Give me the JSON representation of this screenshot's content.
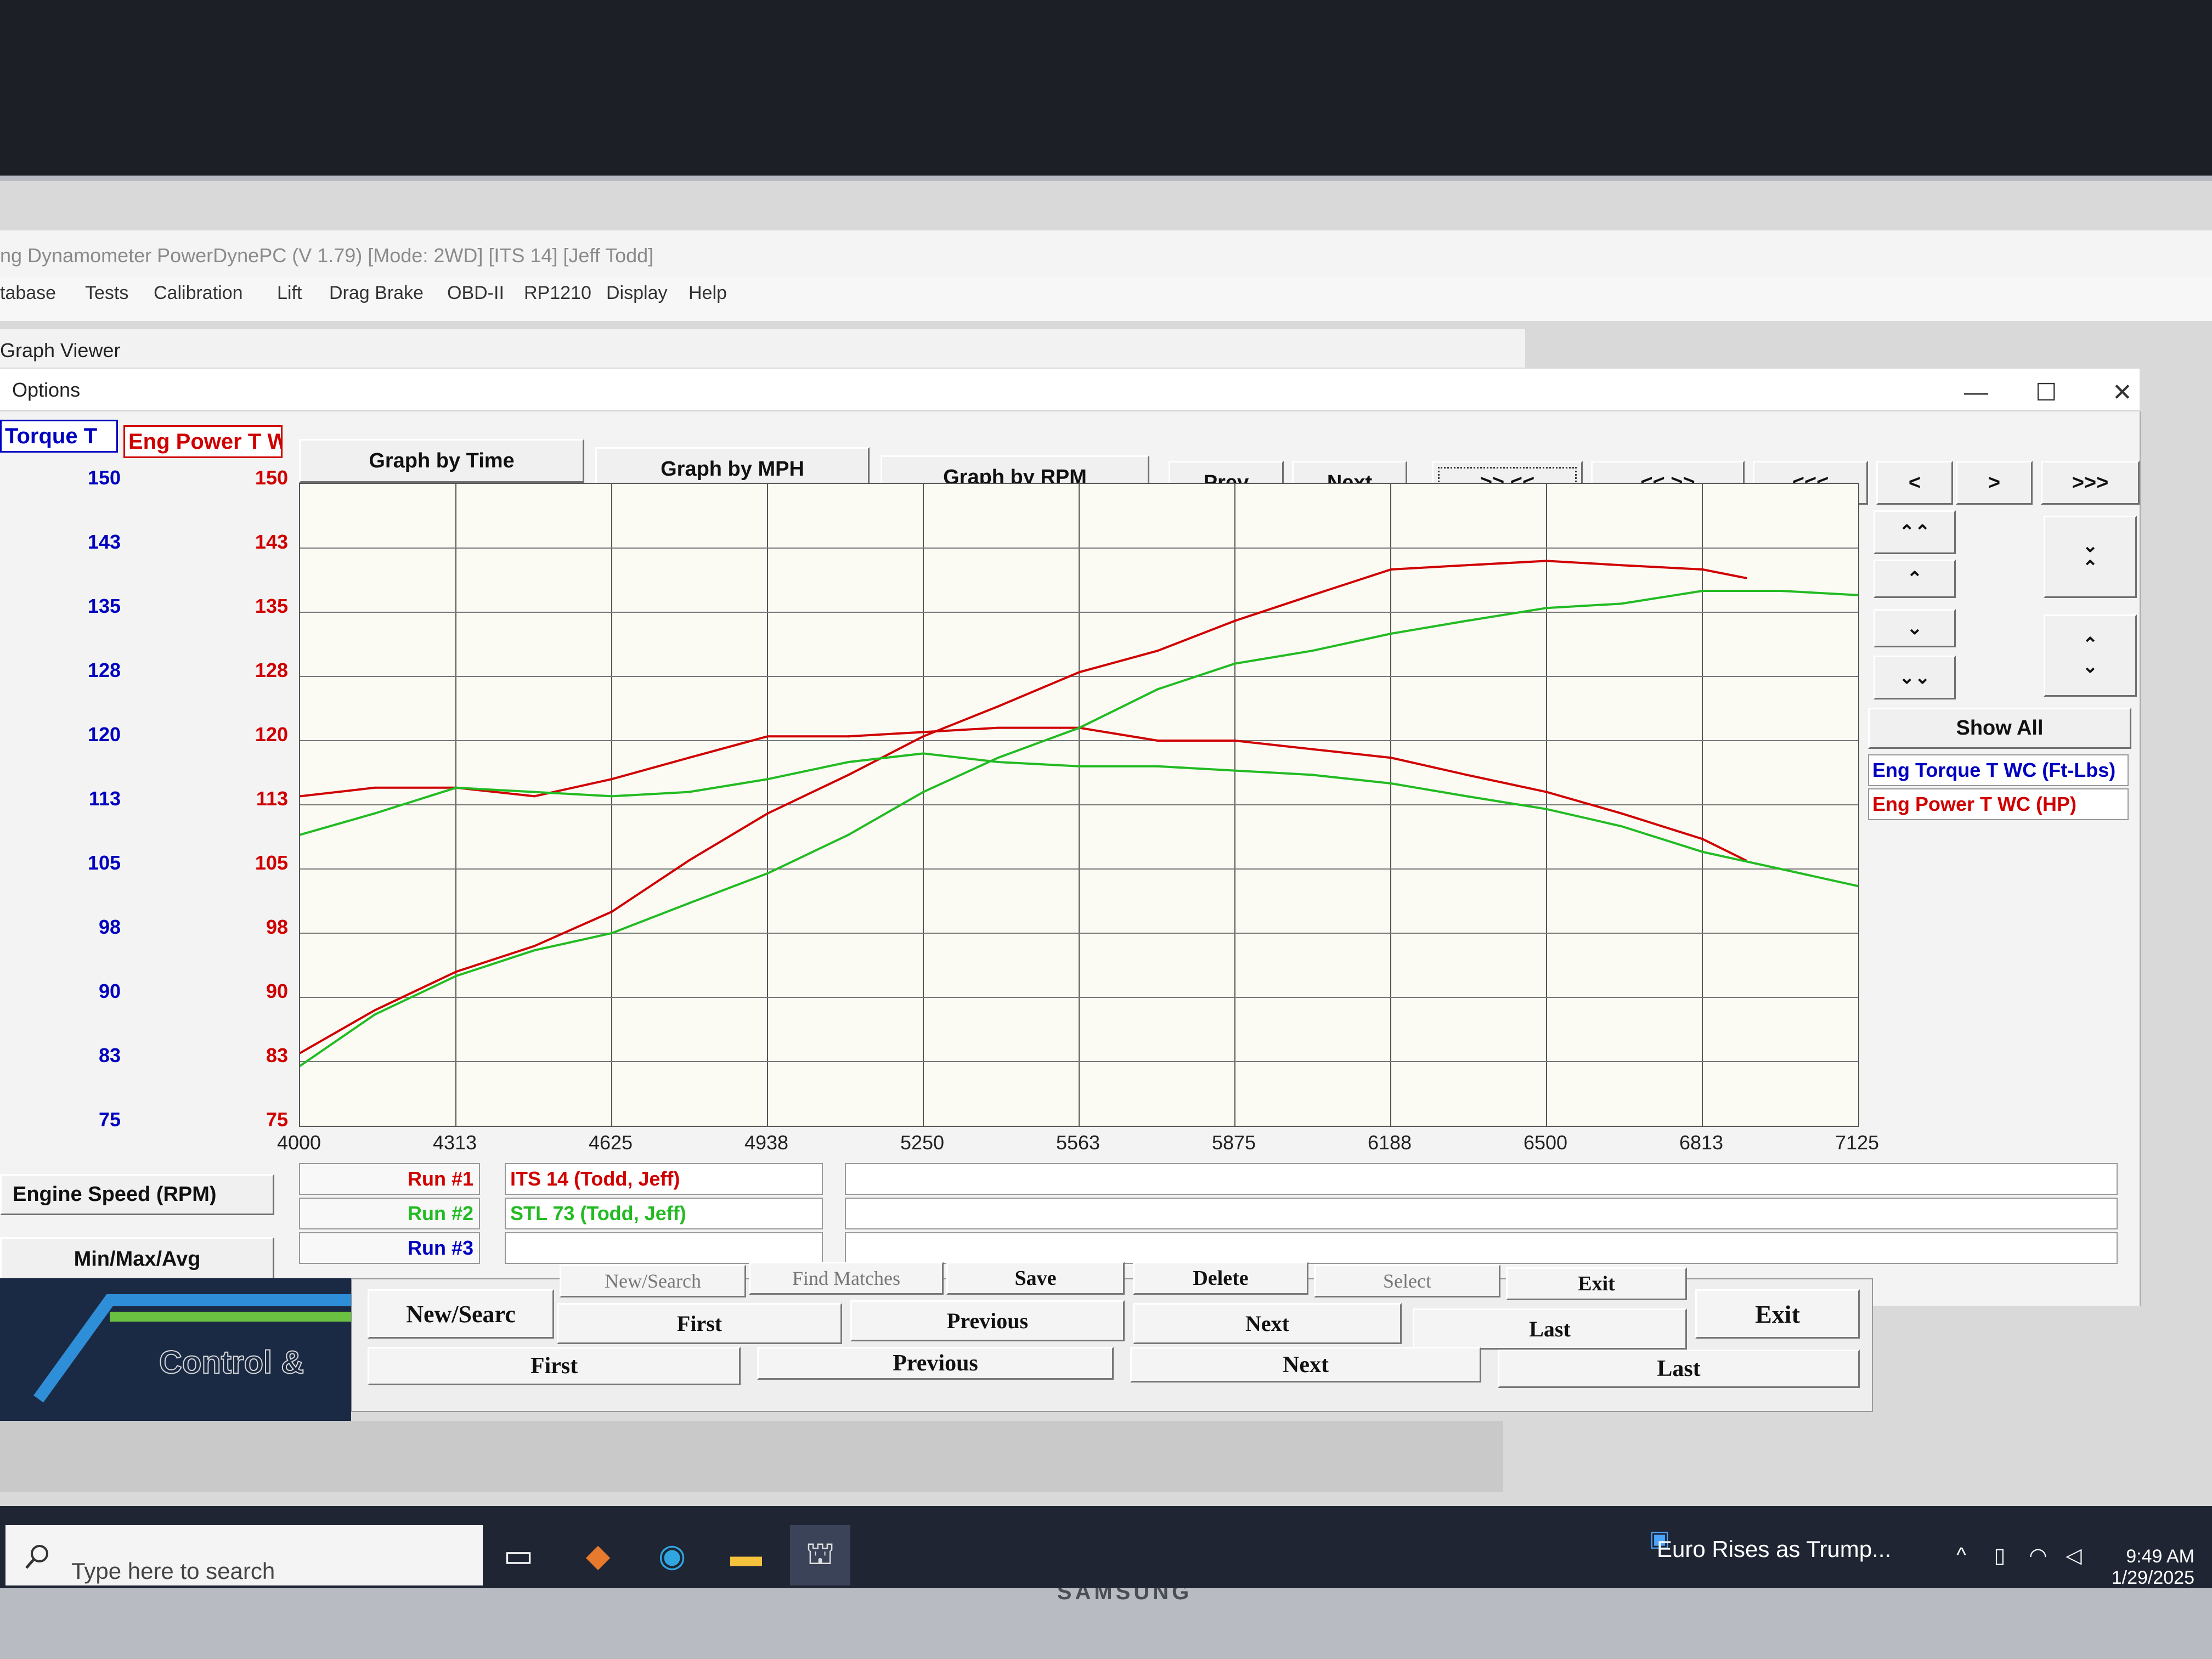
{
  "app": {
    "title": "ng Dynamometer PowerDynePC (V 1.79) [Mode: 2WD] [ITS 14] [Jeff Todd]",
    "menu": [
      "tabase",
      "Tests",
      "Calibration",
      "Lift",
      "Drag Brake",
      "OBD-II",
      "RP1210",
      "Display",
      "Help"
    ]
  },
  "graph_viewer": {
    "title": "Graph Viewer",
    "options_label": "Options",
    "window_controls": {
      "minimize": "—",
      "maximize": "☐",
      "close": "✕"
    },
    "torque_header": "Torque T",
    "power_header": "Eng Power T W",
    "mode_buttons": [
      "Graph by Time",
      "Graph by MPH",
      "Graph by RPM"
    ],
    "nav_buttons": [
      "Prev",
      "Next",
      ">> <<",
      "<< >>",
      "<<<",
      "<",
      ">",
      ">>>"
    ],
    "show_all_label": "Show All",
    "legend": [
      {
        "label": "Eng Torque T WC (Ft-Lbs)",
        "color": "#0000c0"
      },
      {
        "label": "Eng Power T WC (HP)",
        "color": "#d00000"
      }
    ],
    "x_axis_label": "Engine Speed (RPM)",
    "minmax_label": "Min/Max/Avg",
    "runs": [
      {
        "label": "Run #1",
        "name": "ITS 14 (Todd, Jeff)",
        "label_color": "#d00000",
        "name_color": "#d00000"
      },
      {
        "label": "Run #2",
        "name": "STL 73 (Todd, Jeff)",
        "label_color": "#22bb22",
        "name_color": "#22bb22"
      },
      {
        "label": "Run #3",
        "name": "",
        "label_color": "#0000c0",
        "name_color": "#0000c0"
      }
    ]
  },
  "chart_data": {
    "type": "line",
    "x_ticks": [
      "4000",
      "4313",
      "4625",
      "4938",
      "5250",
      "5563",
      "5875",
      "6188",
      "6500",
      "6813",
      "7125"
    ],
    "y_ticks_left": [
      "150",
      "143",
      "135",
      "128",
      "120",
      "113",
      "105",
      "98",
      "90",
      "83",
      "75"
    ],
    "y_ticks_right": [
      "150",
      "143",
      "135",
      "128",
      "120",
      "113",
      "105",
      "98",
      "90",
      "83",
      "75"
    ],
    "xlim": [
      4000,
      7125
    ],
    "ylim": [
      75,
      150
    ],
    "grid": true,
    "series": [
      {
        "run": "ITS 14 (Todd, Jeff)",
        "quantity": "torque",
        "color": "#d00000",
        "x": [
          4000,
          4150,
          4313,
          4470,
          4625,
          4780,
          4938,
          5100,
          5250,
          5400,
          5563,
          5720,
          5875,
          6030,
          6188,
          6340,
          6500,
          6650,
          6813,
          6900
        ],
        "y": [
          113.5,
          114.5,
          114.5,
          113.5,
          115.5,
          118,
          120.5,
          120.5,
          121,
          121.5,
          121.5,
          120,
          120,
          119,
          118,
          116,
          114,
          111.5,
          108.5,
          106
        ]
      },
      {
        "run": "ITS 14 (Todd, Jeff)",
        "quantity": "power",
        "color": "#d00000",
        "x": [
          4000,
          4150,
          4313,
          4470,
          4625,
          4780,
          4938,
          5100,
          5250,
          5400,
          5563,
          5720,
          5875,
          6030,
          6188,
          6340,
          6500,
          6650,
          6813,
          6900
        ],
        "y": [
          83.5,
          88.5,
          93,
          96,
          100,
          106,
          111.5,
          116,
          120.5,
          124,
          128,
          130.5,
          134,
          137,
          140,
          140.5,
          141,
          140.5,
          140,
          139
        ]
      },
      {
        "run": "STL 73 (Todd, Jeff)",
        "quantity": "torque",
        "color": "#22bb22",
        "x": [
          4000,
          4150,
          4313,
          4470,
          4625,
          4780,
          4938,
          5100,
          5250,
          5400,
          5563,
          5720,
          5875,
          6030,
          6188,
          6340,
          6500,
          6650,
          6813,
          6970,
          7125
        ],
        "y": [
          109,
          111.5,
          114.5,
          114,
          113.5,
          114,
          115.5,
          117.5,
          118.5,
          117.5,
          117,
          117,
          116.5,
          116,
          115,
          113.5,
          112,
          110,
          107,
          105,
          103
        ]
      },
      {
        "run": "STL 73 (Todd, Jeff)",
        "quantity": "power",
        "color": "#22bb22",
        "x": [
          4000,
          4150,
          4313,
          4470,
          4625,
          4780,
          4938,
          5100,
          5250,
          5400,
          5563,
          5720,
          5875,
          6030,
          6188,
          6340,
          6500,
          6650,
          6813,
          6970,
          7125
        ],
        "y": [
          82,
          88,
          92.5,
          95.5,
          97.5,
          101,
          104.5,
          109,
          114,
          118,
          121.5,
          126,
          129,
          130.5,
          132.5,
          134,
          135.5,
          136,
          137.5,
          137.5,
          137
        ]
      }
    ]
  },
  "background_window": {
    "top_row": [
      "New/Search",
      "Find Matches",
      "Save",
      "Delete",
      "Select",
      "Exit"
    ],
    "mid_row": [
      "First",
      "Previous",
      "Next",
      "Last"
    ],
    "left_button": "New/Searc",
    "right_exit": "Exit",
    "bottom_row": [
      "First",
      "Previous",
      "Next",
      "Last"
    ],
    "logo_text": "Control &"
  },
  "monitor_brand": "SAMSUNG",
  "taskbar": {
    "search_placeholder": "Type here to search",
    "news": "Euro Rises as Trump...",
    "time": "9:49 AM",
    "date": "1/29/2025"
  }
}
